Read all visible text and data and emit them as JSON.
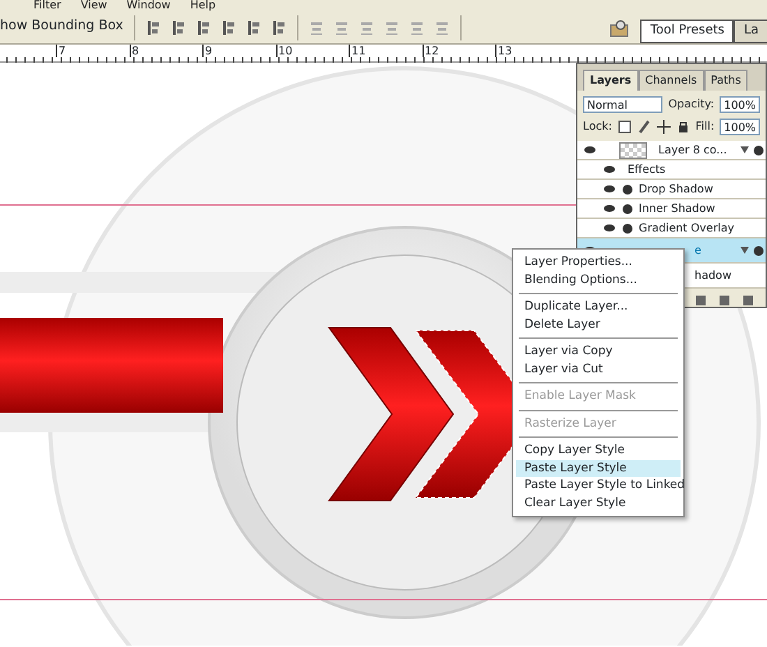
{
  "menu_bar": [
    "Filter",
    "View",
    "Window",
    "Help"
  ],
  "options_bar": {
    "bounding_box_label": "how Bounding Box",
    "panel_tabs": [
      {
        "label": "Tool Presets",
        "selected": true
      },
      {
        "label": "La",
        "selected": false
      }
    ]
  },
  "ruler": [
    "7",
    "8",
    "9",
    "10",
    "11",
    "12",
    "13"
  ],
  "layers_panel": {
    "tabs": [
      {
        "label": "Layers",
        "selected": true
      },
      {
        "label": "Channels",
        "selected": false
      },
      {
        "label": "Paths",
        "selected": false
      }
    ],
    "blend_mode": "Normal",
    "opacity_label": "Opacity:",
    "opacity": "100%",
    "lock_label": "Lock:",
    "fill_label": "Fill:",
    "fill": "100%",
    "rows": [
      {
        "kind": "layer",
        "name": "Layer 8 co...",
        "selected": false
      },
      {
        "kind": "header",
        "name": "Effects",
        "selected": false
      },
      {
        "kind": "effect",
        "name": "Drop Shadow",
        "selected": false
      },
      {
        "kind": "effect",
        "name": "Inner Shadow",
        "selected": false
      },
      {
        "kind": "effect",
        "name": "Gradient Overlay",
        "selected": false
      },
      {
        "kind": "layer_partial",
        "name": "e",
        "selected": true
      },
      {
        "kind": "effect_partial",
        "name": "hadow",
        "selected": false
      }
    ]
  },
  "context_menu": [
    {
      "kind": "item",
      "label": "Layer Properties...",
      "disabled": false,
      "selected": false
    },
    {
      "kind": "item",
      "label": "Blending Options...",
      "disabled": false,
      "selected": false
    },
    {
      "kind": "separator"
    },
    {
      "kind": "item",
      "label": "Duplicate Layer...",
      "disabled": false,
      "selected": false
    },
    {
      "kind": "item",
      "label": "Delete Layer",
      "disabled": false,
      "selected": false
    },
    {
      "kind": "separator"
    },
    {
      "kind": "item",
      "label": "Layer via Copy",
      "disabled": false,
      "selected": false
    },
    {
      "kind": "item",
      "label": "Layer via Cut",
      "disabled": false,
      "selected": false
    },
    {
      "kind": "separator"
    },
    {
      "kind": "item",
      "label": "Enable Layer Mask",
      "disabled": true,
      "selected": false
    },
    {
      "kind": "separator"
    },
    {
      "kind": "item",
      "label": "Rasterize Layer",
      "disabled": true,
      "selected": false
    },
    {
      "kind": "separator"
    },
    {
      "kind": "item",
      "label": "Copy Layer Style",
      "disabled": false,
      "selected": false
    },
    {
      "kind": "item",
      "label": "Paste Layer Style",
      "disabled": false,
      "selected": true
    },
    {
      "kind": "item",
      "label": "Paste Layer Style to Linked",
      "disabled": false,
      "selected": false
    },
    {
      "kind": "item",
      "label": "Clear Layer Style",
      "disabled": false,
      "selected": false
    }
  ]
}
